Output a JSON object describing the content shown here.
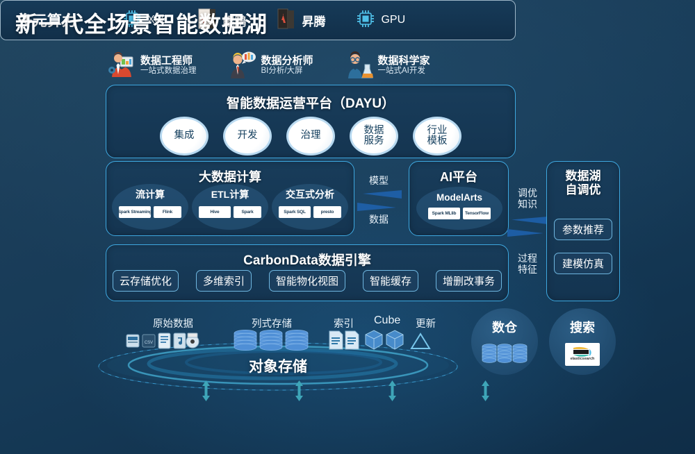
{
  "title": "新一代全场景智能数据湖",
  "personas": [
    {
      "icon": "data-engineer-avatar-icon",
      "name": "数据工程师",
      "desc": "一站式数据治理"
    },
    {
      "icon": "data-analyst-avatar-icon",
      "name": "数据分析师",
      "desc": "BI分析/大屏"
    },
    {
      "icon": "data-scientist-avatar-icon",
      "name": "数据科学家",
      "desc": "一站式AI开发"
    }
  ],
  "dayu": {
    "title": "智能数据运营平台（DAYU）",
    "bubbles": [
      {
        "line1": "集成",
        "line2": ""
      },
      {
        "line1": "开发",
        "line2": ""
      },
      {
        "line1": "治理",
        "line2": ""
      },
      {
        "line1": "数据",
        "line2": "服务"
      },
      {
        "line1": "行业",
        "line2": "模板"
      }
    ]
  },
  "bigdata": {
    "title": "大数据计算",
    "groups": [
      {
        "label": "流计算",
        "logos": [
          "Spark Streaming",
          "Flink"
        ]
      },
      {
        "label": "ETL计算",
        "logos": [
          "Hive",
          "Spark"
        ]
      },
      {
        "label": "交互式分析",
        "logos": [
          "Spark SQL",
          "presto"
        ]
      }
    ]
  },
  "ai_platform": {
    "title": "AI平台",
    "product": "ModelArts",
    "logos": [
      "Spark MLlib",
      "TensorFlow"
    ]
  },
  "flow_labels": {
    "model": "模型",
    "data": "数据",
    "tuning_knowledge_l1": "调优",
    "tuning_knowledge_l2": "知识",
    "process_feature_l1": "过程",
    "process_feature_l2": "特征"
  },
  "carbon": {
    "title": "CarbonData数据引擎",
    "chips": [
      "云存储优化",
      "多维索引",
      "智能物化视图",
      "智能缓存",
      "增删改事务"
    ]
  },
  "tuning": {
    "title_l1": "数据湖",
    "title_l2": "自调优",
    "chips": [
      "参数推荐",
      "建模仿真"
    ]
  },
  "storage": {
    "object_store": "对象存储",
    "categories": [
      {
        "label": "原始数据",
        "icon": "mixed-files-icon"
      },
      {
        "label": "列式存储",
        "icon": "columnar-db-icon"
      },
      {
        "label": "索引",
        "icon": "index-docs-icon"
      },
      {
        "label": "Cube",
        "icon": "cube-icon"
      },
      {
        "label": "更新",
        "icon": "delta-triangle-icon"
      }
    ]
  },
  "right_circles": [
    {
      "label": "数仓",
      "icon": "database-stack-icon"
    },
    {
      "label": "搜索",
      "icon": "elasticsearch-logo-icon",
      "logo_text": "elasticsearch"
    }
  ],
  "compute": {
    "label": "多元算力",
    "items": [
      {
        "name": "X86",
        "icon": "cpu-chip-icon",
        "type": "en"
      },
      {
        "name": "鲲鹏",
        "icon": "kunpeng-chip-icon",
        "type": "cn"
      },
      {
        "name": "昇腾",
        "icon": "ascend-chip-icon",
        "type": "cn"
      },
      {
        "name": "GPU",
        "icon": "gpu-chip-icon",
        "type": "en"
      }
    ]
  },
  "colors": {
    "background": "#163a57",
    "accent": "#3ea8e0",
    "arrow_teal": "#36a3b8",
    "panel_fill": "#1a3a56",
    "text": "#ffffff"
  }
}
